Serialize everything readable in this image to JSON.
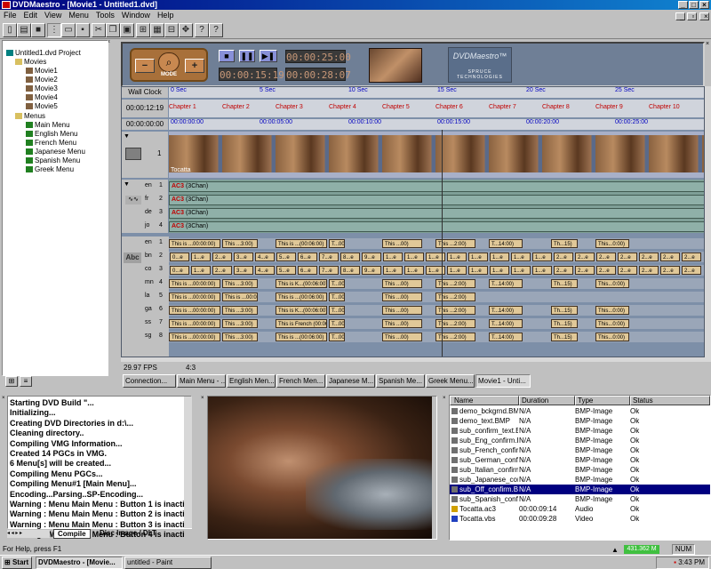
{
  "app": {
    "title": "DVDMaestro - [Movie1 - Untitled1.dvd]"
  },
  "menu": [
    "File",
    "Edit",
    "View",
    "Menu",
    "Tools",
    "Window",
    "Help"
  ],
  "tree": {
    "project": "Untitled1.dvd Project",
    "movies_label": "Movies",
    "movies": [
      "Movie1",
      "Movie2",
      "Movie3",
      "Movie4",
      "Movie5"
    ],
    "menus_label": "Menus",
    "menus": [
      "Main Menu",
      "English Menu",
      "French Menu",
      "Japanese Menu",
      "Spanish Menu",
      "Greek Menu"
    ]
  },
  "controls": {
    "mode_label": "MODE",
    "time_a": "00:00:15:19",
    "time_b": "00:00:25:00",
    "time_c": "00:00:28:07",
    "logo_title": "DVDMaestro™",
    "logo_brand": "SPRUCE TECHNOLOGIES"
  },
  "timeline": {
    "wall_clock_label": "Wall Clock",
    "wall_ticks": [
      "0 Sec",
      "5 Sec",
      "10 Sec",
      "15 Sec",
      "20 Sec",
      "25 Sec"
    ],
    "chapter_time": "00:00:12:19",
    "chapters": [
      "Chapter 1",
      "Chapter 2",
      "Chapter 3",
      "Chapter 4",
      "Chapter 5",
      "Chapter 6",
      "Chapter 7",
      "Chapter 8",
      "Chapter 9",
      "Chapter 10"
    ],
    "tc_time": "00:00:00:00",
    "tc_ticks": [
      "00:00:00:00",
      "00:00:05:00",
      "00:00:10:00",
      "00:00:15:00",
      "00:00:20:00",
      "00:00:25:00"
    ],
    "video_track_num": "1",
    "video_clip": "Tocatta",
    "audio_tracks": [
      {
        "lang": "en",
        "num": "1",
        "codec": "AC3",
        "ch": "(3Chan)"
      },
      {
        "lang": "fr",
        "num": "2",
        "codec": "AC3",
        "ch": "(3Chan)"
      },
      {
        "lang": "de",
        "num": "3",
        "codec": "AC3",
        "ch": "(3Chan)"
      },
      {
        "lang": "jo",
        "num": "4",
        "codec": "AC3",
        "ch": "(3Chan)"
      }
    ],
    "sub_icon": "Abc",
    "sub_tracks": [
      {
        "lang": "en",
        "num": "1",
        "cells": [
          "This is ...00:00:00)",
          "This ...3:00)",
          "This is ...(00:06:00)",
          "T...00)",
          "This ...00)",
          "This ...2:00)",
          "T...14:00)",
          "Th...15)",
          "This...0:00)",
          "This is ...00:25:00)"
        ]
      },
      {
        "lang": "bn",
        "num": "2",
        "cells": [
          "0...e",
          "1...e",
          "2...e",
          "3...e",
          "4...e",
          "5...e",
          "6...e",
          "7...e",
          "8...e",
          "9...e",
          "1...e",
          "1...e",
          "1...e",
          "1...e",
          "1...e",
          "1...e",
          "1...e",
          "1...e",
          "2...e",
          "2...e",
          "2...e",
          "2...e",
          "2...e",
          "2...e",
          "2...e"
        ]
      },
      {
        "lang": "co",
        "num": "3",
        "cells": [
          "0...e",
          "1...e",
          "2...e",
          "3...e",
          "4...e",
          "5...e",
          "6...e",
          "7...e",
          "8...e",
          "9...e",
          "1...e",
          "1...e",
          "1...e",
          "1...e",
          "1...e",
          "1...e",
          "1...e",
          "1...e",
          "2...e",
          "2...e",
          "2...e",
          "2...e",
          "2...e",
          "2...e",
          "2...e"
        ]
      },
      {
        "lang": "mn",
        "num": "4",
        "cells": [
          "This is ...00:00:00)",
          "This ...3:00)",
          "This is K...(00:06:00)",
          "T...00)",
          "This ...00)",
          "This ...2:00)",
          "T...14:00)",
          "Th...15)",
          "This...0:00)",
          "This is ...00:25:00)"
        ]
      },
      {
        "lang": "la",
        "num": "5",
        "cells": [
          "This is ...00:00:00)",
          "This is ...00:03:00)",
          "This is ...(00:06:00)",
          "T...00)",
          "This ...00)",
          "This ...2:00)"
        ]
      },
      {
        "lang": "ga",
        "num": "6",
        "cells": [
          "This is ...00:00:00)",
          "This ...3:00)",
          "This is K...(00:06:00)",
          "T...00)",
          "This ...00)",
          "This ...2:00)",
          "T...14:00)",
          "Th...15)",
          "This...0:00)",
          "This is ...0:25:00)"
        ]
      },
      {
        "lang": "ss",
        "num": "7",
        "cells": [
          "This is ...00:00:00)",
          "This ...3:00)",
          "This is French (00:06:00)",
          "T...00)",
          "This ...00)",
          "This ...2:00)",
          "T...14:00)",
          "Th...15)",
          "This...0:00)",
          "This is Fr...(00:25:00)"
        ]
      },
      {
        "lang": "sg",
        "num": "8",
        "cells": [
          "This is ...00:00:00)",
          "This ...3:00)",
          "This is ...(00:06:00)",
          "T...00)",
          "This ...00)",
          "This ...2:00)",
          "T...14:00)",
          "Th...15)",
          "This...0:00)",
          "This is G...(00:25:00)"
        ]
      }
    ],
    "fps": "29.97 FPS",
    "aspect": "4:3"
  },
  "tabs": [
    "Connection...",
    "Main Menu - ...",
    "English Men...",
    "French Men...",
    "Japanese M...",
    "Spanish Me...",
    "Greek Menu...",
    "Movie1 - Unti..."
  ],
  "log": {
    "lines": [
      "Starting DVD Build \"...",
      "Initializing...",
      "Creating DVD Directories in d:\\...",
      "Cleaning directory..",
      "Compiling VMG Information...",
      "Created 14 PGCs in VMG.",
      "6 Menu[s] will be created...",
      "Compiling Menu PGCs...",
      "Compiling Menu#1 [Main Menu]...",
      "Encoding...Parsing..SP-Encoding...",
      "Warning : Menu Main Menu : Button 1 is inactive",
      "Warning : Menu Main Menu : Button 2 is inactive",
      "Warning : Menu Main Menu : Button 3 is inactive",
      "Warning : Menu Main Menu : Button 4 is inactive"
    ],
    "tab_compile": "Compile",
    "tab_disc": "Disc Image / DLT"
  },
  "assets": {
    "headers": [
      "Name",
      "Duration",
      "Type",
      "Status"
    ],
    "rows": [
      {
        "name": "demo_bckgrnd.BMP",
        "duration": "N/A",
        "type": "BMP-Image",
        "status": "Ok",
        "sel": false
      },
      {
        "name": "demo_text.BMP",
        "duration": "N/A",
        "type": "BMP-Image",
        "status": "Ok",
        "sel": false
      },
      {
        "name": "sub_confirm_text.BMP",
        "duration": "N/A",
        "type": "BMP-Image",
        "status": "Ok",
        "sel": false
      },
      {
        "name": "sub_Eng_confirm.BMP",
        "duration": "N/A",
        "type": "BMP-Image",
        "status": "Ok",
        "sel": false
      },
      {
        "name": "sub_French_confirm.BMP",
        "duration": "N/A",
        "type": "BMP-Image",
        "status": "Ok",
        "sel": false
      },
      {
        "name": "sub_German_confirm.BMP",
        "duration": "N/A",
        "type": "BMP-Image",
        "status": "Ok",
        "sel": false
      },
      {
        "name": "sub_Italian_confirm.BMP",
        "duration": "N/A",
        "type": "BMP-Image",
        "status": "Ok",
        "sel": false
      },
      {
        "name": "sub_Japanese_confirm.BMP",
        "duration": "N/A",
        "type": "BMP-Image",
        "status": "Ok",
        "sel": false
      },
      {
        "name": "sub_Off_confirm.BMP",
        "duration": "N/A",
        "type": "BMP-Image",
        "status": "Ok",
        "sel": true
      },
      {
        "name": "sub_Spanish_confirm.BMP",
        "duration": "N/A",
        "type": "BMP-Image",
        "status": "Ok",
        "sel": false
      },
      {
        "name": "Tocatta.ac3",
        "duration": "00:00:09:14",
        "type": "Audio",
        "status": "Ok",
        "sel": false
      },
      {
        "name": "Tocatta.vbs",
        "duration": "00:00:09:28",
        "type": "Video",
        "status": "Ok",
        "sel": false
      }
    ]
  },
  "status": {
    "help": "For Help, press F1",
    "memory": "431.362 M",
    "num": "NUM"
  },
  "taskbar": {
    "start": "Start",
    "tasks": [
      "DVDMaestro - [Movie...",
      "untitled - Paint"
    ],
    "clock": "3:43 PM"
  },
  "colors": {
    "title_from": "#000080",
    "title_to": "#1084d0",
    "timeline_bg": "#7d8fa8",
    "audio_bg": "#7f9f97",
    "selected": "#000080",
    "lcd_text": "#c89878"
  }
}
